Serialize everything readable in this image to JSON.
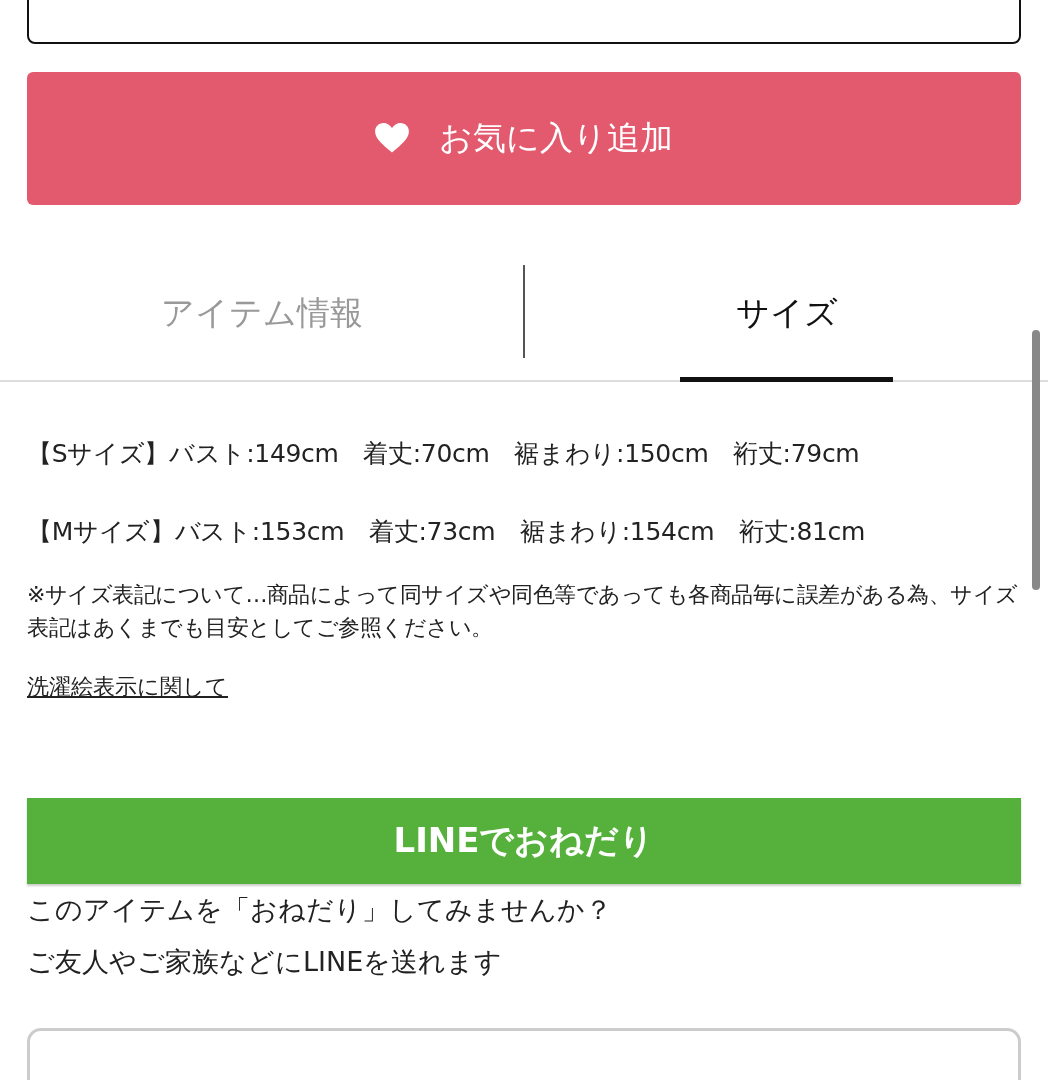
{
  "favorite_button": {
    "label": "お気に入り追加"
  },
  "tabs": [
    {
      "label": "アイテム情報",
      "selected": false
    },
    {
      "label": "サイズ",
      "selected": true
    }
  ],
  "sizes": [
    "【Sサイズ】バスト:149cm　着丈:70cm　裾まわり:150cm　裄丈:79cm",
    "【Mサイズ】バスト:153cm　着丈:73cm　裾まわり:154cm　裄丈:81cm"
  ],
  "size_note": "※サイズ表記について…商品によって同サイズや同色等であっても各商品毎に誤差がある為、サイズ表記はあくまでも目安としてご参照ください。",
  "care_link": "洗濯絵表示に関して",
  "line_button": {
    "label": "LINEでおねだり"
  },
  "line_description": [
    "このアイテムを「おねだり」してみませんか？",
    "ご友人やご家族などにLINEを送れます"
  ]
}
